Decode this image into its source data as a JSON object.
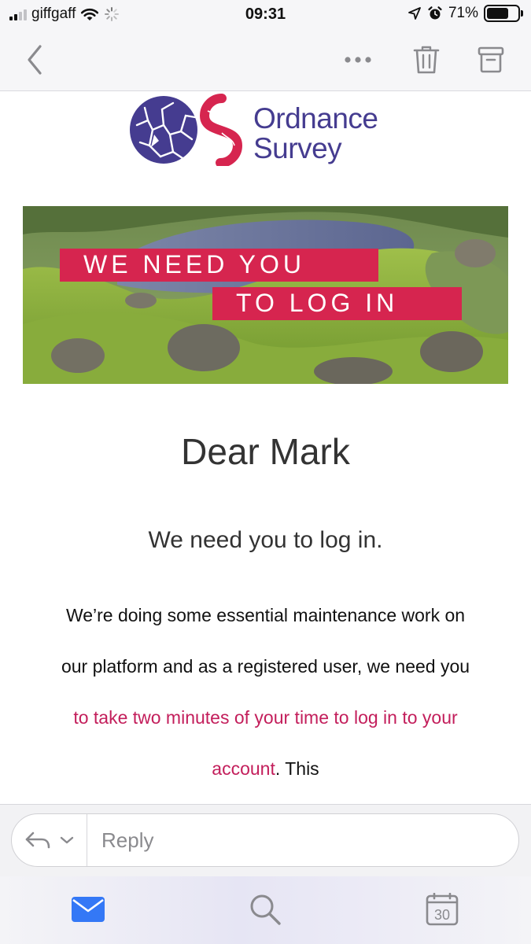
{
  "status_bar": {
    "carrier": "giffgaff",
    "time": "09:31",
    "battery_percent": "71%",
    "battery_level": 0.71,
    "signal_bars": 2,
    "icons": [
      "signal-icon",
      "wifi-icon",
      "activity-spinner-icon",
      "location-arrow-icon",
      "alarm-icon",
      "battery-icon"
    ]
  },
  "toolbar": {
    "icons": [
      "back-chevron-icon",
      "more-icon",
      "trash-icon",
      "archive-icon"
    ]
  },
  "email": {
    "logo": {
      "line1": "Ordnance",
      "line2": "Survey"
    },
    "banner": {
      "line1": "WE NEED YOU",
      "line2": "TO LOG IN"
    },
    "greeting": "Dear Mark",
    "subheading": "We need you to log in.",
    "body": {
      "p1": "We’re doing some essential maintenance work on our platform and as a registered user,  we need you ",
      "link": "to take two minutes of your time to log in to your account",
      "p2": ". This"
    }
  },
  "reply_bar": {
    "placeholder": "Reply",
    "icons": [
      "reply-arrow-icon",
      "chevron-down-icon"
    ]
  },
  "tab_bar": {
    "calendar_day": "30",
    "icons": [
      "mail-icon",
      "search-icon",
      "calendar-icon"
    ]
  },
  "colors": {
    "brand_purple": "#453c90",
    "brand_pink": "#d6254f",
    "link_color": "#c31e5b",
    "ios_blue": "#3478f6"
  }
}
